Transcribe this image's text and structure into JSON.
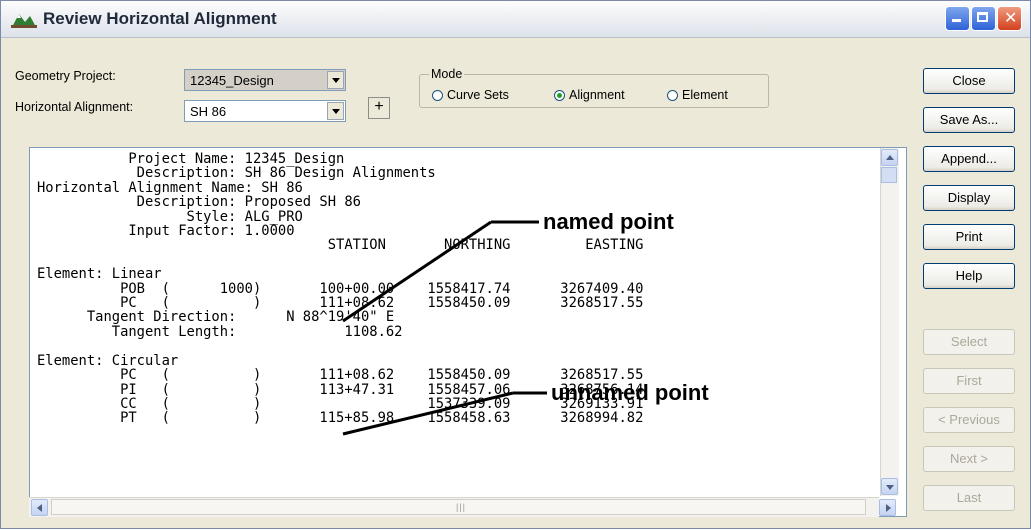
{
  "window": {
    "title": "Review Horizontal Alignment",
    "controls": {
      "minimize": "minimize-icon",
      "maximize": "maximize-icon",
      "close": "close-icon"
    }
  },
  "form": {
    "geometry_project_label": "Geometry Project:",
    "geometry_project_value": "12345_Design",
    "horizontal_alignment_label": "Horizontal Alignment:",
    "horizontal_alignment_value": "SH 86",
    "pick_button": "+"
  },
  "mode": {
    "title": "Mode",
    "options": [
      {
        "label": "Curve Sets",
        "selected": false
      },
      {
        "label": "Alignment",
        "selected": true
      },
      {
        "label": "Element",
        "selected": false
      }
    ]
  },
  "buttons": [
    {
      "label": "Close",
      "enabled": true
    },
    {
      "label": "Save As...",
      "enabled": true
    },
    {
      "label": "Append...",
      "enabled": true
    },
    {
      "label": "Display",
      "enabled": true
    },
    {
      "label": "Print",
      "enabled": true
    },
    {
      "label": "Help",
      "enabled": true
    },
    {
      "label": "Select",
      "enabled": false
    },
    {
      "label": "First",
      "enabled": false
    },
    {
      "label": "< Previous",
      "enabled": false
    },
    {
      "label": "Next >",
      "enabled": false
    },
    {
      "label": "Last",
      "enabled": false
    }
  ],
  "report_lines": [
    "           Project Name: 12345_Design",
    "            Description: SH 86 Design Alignments",
    "Horizontal Alignment Name: SH 86",
    "            Description: Proposed SH 86",
    "                  Style: ALG_PRO",
    "           Input Factor: 1.0000",
    "                                   STATION       NORTHING         EASTING",
    "",
    "Element: Linear",
    "          POB  (      1000)       100+00.00    1558417.74      3267409.40",
    "          PC   (          )       111+08.62    1558450.09      3268517.55",
    "      Tangent Direction:      N 88^19'40\" E",
    "         Tangent Length:             1108.62",
    "",
    "Element: Circular",
    "          PC   (          )       111+08.62    1558450.09      3268517.55",
    "          PI   (          )       113+47.31    1558457.06      3268756.14",
    "          CC   (          )                    1537339.09      3269133.91",
    "          PT   (          )       115+85.98    1558458.63      3268994.82"
  ],
  "annotations": {
    "named": "named point",
    "unnamed": "unnamed point"
  },
  "scrollbar": {
    "grip": "|||"
  }
}
